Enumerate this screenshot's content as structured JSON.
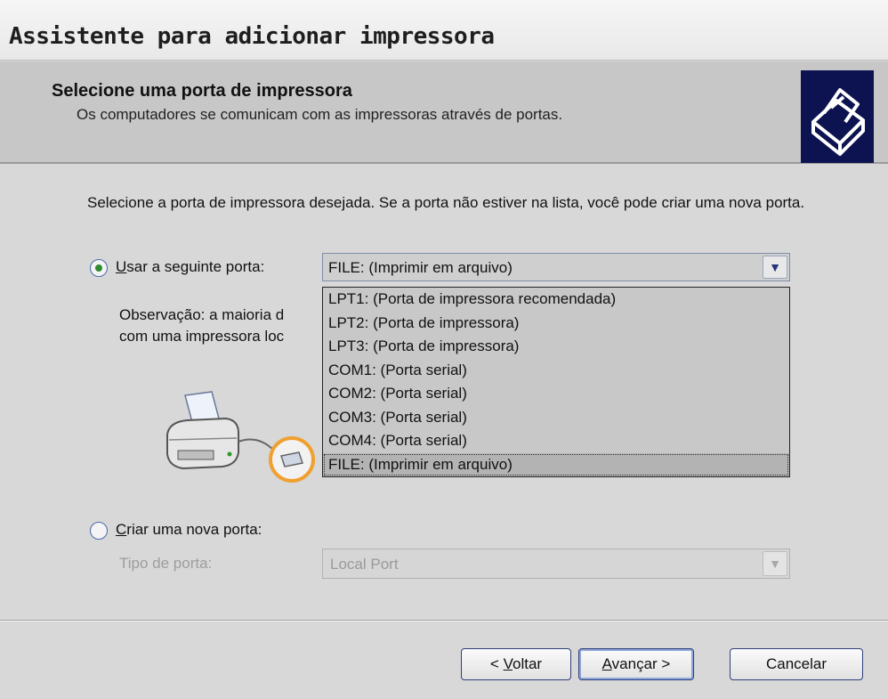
{
  "window": {
    "title": "Assistente para adicionar impressora"
  },
  "header": {
    "title": "Selecione uma porta de impressora",
    "subtitle": "Os computadores se comunicam com as impressoras através de portas.",
    "icon": "printer-icon"
  },
  "main": {
    "instruction": "Selecione a porta de impressora desejada. Se a porta não estiver na lista, você pode criar uma nova porta.",
    "use_port": {
      "label_mnemonic": "U",
      "label_rest": "sar a seguinte porta:",
      "checked": true,
      "selected_value": "FILE: (Imprimir em arquivo)",
      "options": [
        "LPT1: (Porta de impressora recomendada)",
        "LPT2: (Porta de impressora)",
        "LPT3: (Porta de impressora)",
        "COM1: (Porta serial)",
        "COM2: (Porta serial)",
        "COM3: (Porta serial)",
        "COM4: (Porta serial)",
        "FILE: (Imprimir em arquivo)"
      ],
      "selected_index": 7
    },
    "note": {
      "line1": "Observação: a maioria d",
      "line2": "com uma impressora loc"
    },
    "create_port": {
      "label_mnemonic": "C",
      "label_rest": "riar uma nova porta:",
      "checked": false,
      "type_label": "Tipo de porta:",
      "type_value": "Local Port"
    }
  },
  "buttons": {
    "back_prefix": "< ",
    "back_mnemonic": "V",
    "back_rest": "oltar",
    "next_mnemonic": "A",
    "next_rest": "vançar >",
    "cancel": "Cancelar"
  },
  "colors": {
    "header_bg": "#c7c7c7",
    "icon_bg": "#0d1350",
    "radio_dot": "#2f8b2f",
    "port_highlight": "#f0a030"
  }
}
